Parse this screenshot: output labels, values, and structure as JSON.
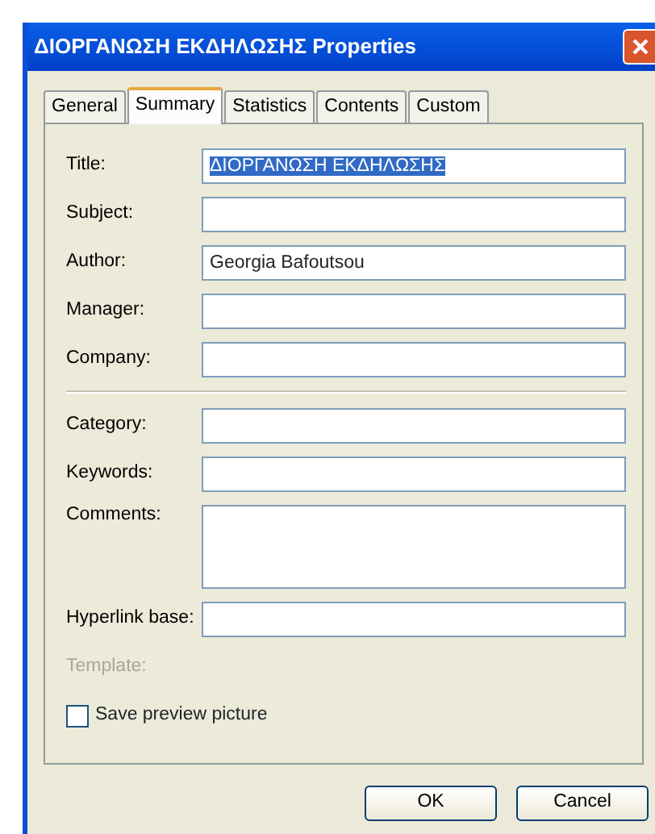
{
  "window": {
    "title": "ΔΙΟΡΓΑΝΩΣΗ ΕΚΔΗΛΩΣΗΣ Properties"
  },
  "tabs": [
    {
      "label": "General",
      "selected": false
    },
    {
      "label": "Summary",
      "selected": true
    },
    {
      "label": "Statistics",
      "selected": false
    },
    {
      "label": "Contents",
      "selected": false
    },
    {
      "label": "Custom",
      "selected": false
    }
  ],
  "field_groups": [
    [
      {
        "label": "Title:",
        "kind": "text",
        "value": "ΔΙΟΡΓΑΝΩΣΗ ΕΚΔΗΛΩΣΗΣ",
        "value_highlighted": true
      },
      {
        "label": "Subject:",
        "kind": "text"
      },
      {
        "label": "Author:",
        "kind": "text",
        "value": "Georgia Bafoutsou",
        "value_highlighted": false
      },
      {
        "label": "Manager:",
        "kind": "text"
      },
      {
        "label": "Company:",
        "kind": "text"
      }
    ],
    [
      {
        "label": "Category:",
        "kind": "text"
      },
      {
        "label": "Keywords:",
        "kind": "text"
      },
      {
        "label": "Comments:",
        "kind": "multiline"
      },
      {
        "label": "Hyperlink base:",
        "kind": "text"
      },
      {
        "label": "Template:",
        "kind": "disabled"
      }
    ]
  ],
  "save_preview": {
    "label": "Save preview picture",
    "checked": false
  },
  "buttons": [
    "OK",
    "Cancel"
  ]
}
